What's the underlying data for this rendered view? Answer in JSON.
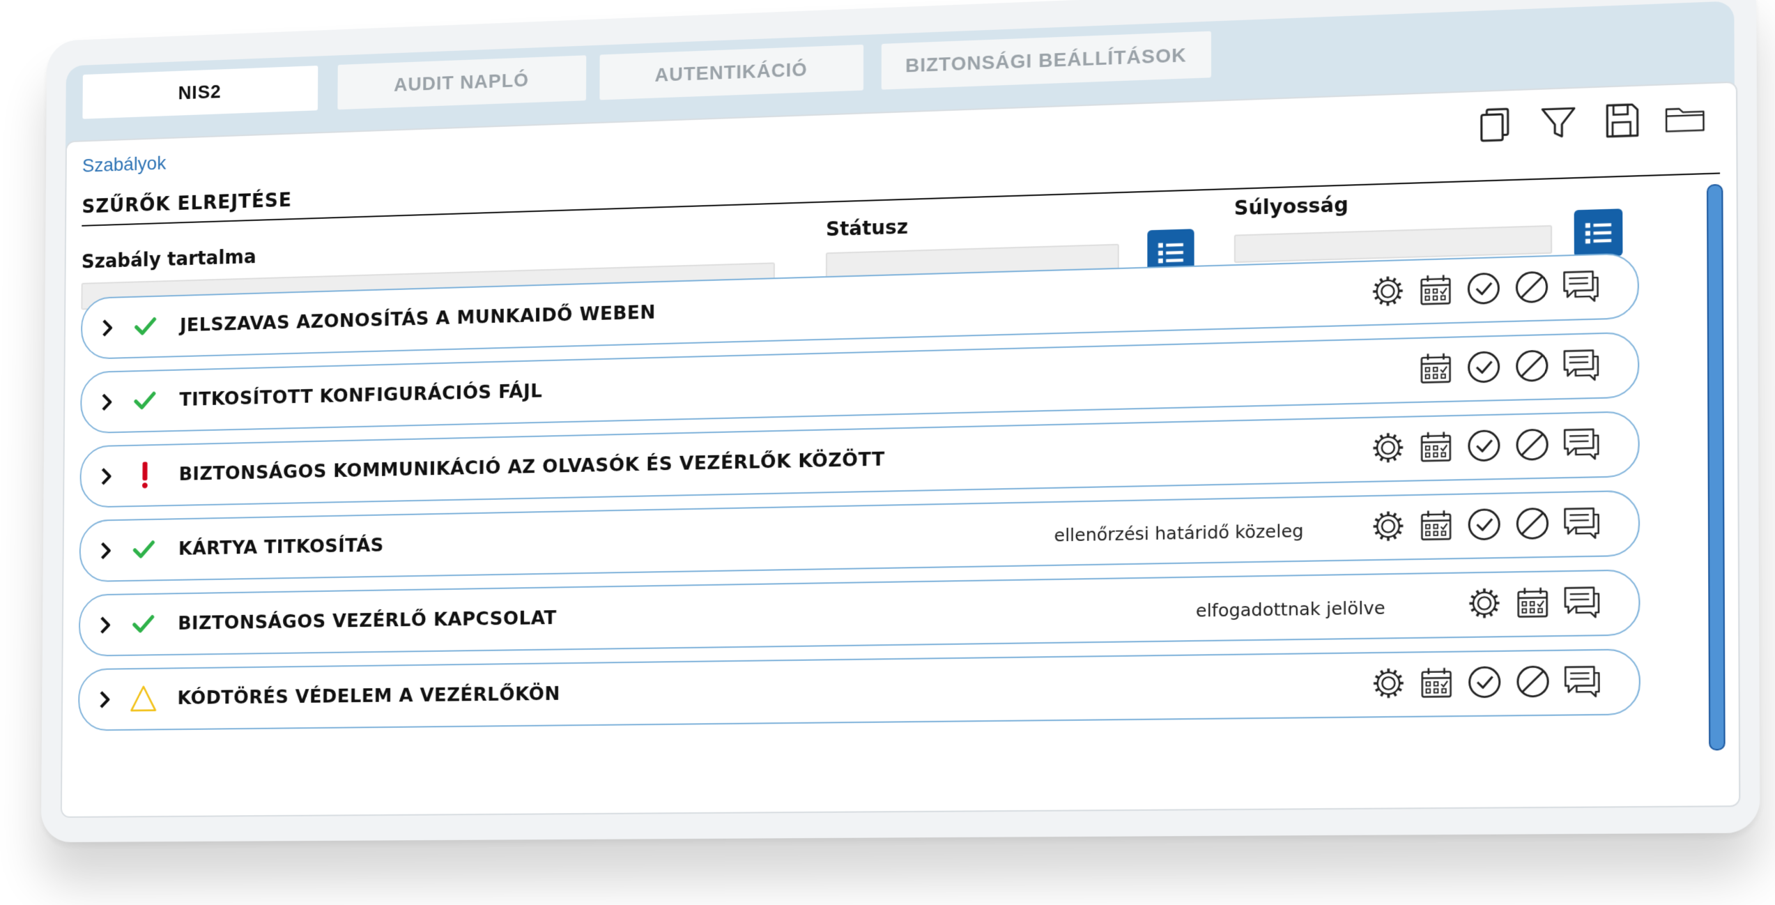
{
  "tabs": [
    {
      "label": "NIS2",
      "active": true
    },
    {
      "label": "AUDIT NAPLÓ",
      "active": false
    },
    {
      "label": "AUTENTIKÁCIÓ",
      "active": false
    },
    {
      "label": "BIZTONSÁGI BEÁLLÍTÁSOK",
      "active": false
    }
  ],
  "breadcrumb": "Szabályok",
  "hide_filters_label": "SZŰRŐK ELREJTÉSE",
  "toolbar_icons": [
    "copy-icon",
    "filter-icon",
    "save-icon",
    "folder-icon"
  ],
  "filters": {
    "rule_content": {
      "label": "Szabály tartalma",
      "value": ""
    },
    "status": {
      "label": "Státusz",
      "value": ""
    },
    "severity": {
      "label": "Súlyosság",
      "value": ""
    }
  },
  "colors": {
    "accent": "#1460a8",
    "link": "#2f74b5",
    "ok_green": "#2fb24a",
    "error_red": "#d0021b",
    "warn_yellow": "#f2c21b",
    "row_border": "#7fb2da",
    "tabbar_bg": "#d6e4ed"
  },
  "rules": [
    {
      "title": "JELSZAVAS AZONOSÍTÁS A MUNKAIDŐ WEBEN",
      "status": "ok",
      "note": "",
      "actions": [
        "gear-icon",
        "calendar-icon",
        "check-circle-icon",
        "block-icon",
        "comment-icon"
      ]
    },
    {
      "title": "TITKOSÍTOTT KONFIGURÁCIÓS FÁJL",
      "status": "ok",
      "note": "",
      "actions": [
        "calendar-icon",
        "check-circle-icon",
        "block-icon",
        "comment-icon"
      ]
    },
    {
      "title": "BIZTONSÁGOS KOMMUNIKÁCIÓ AZ OLVASÓK ÉS VEZÉRLŐK KÖZÖTT",
      "status": "error",
      "note": "",
      "actions": [
        "gear-icon",
        "calendar-icon",
        "check-circle-icon",
        "block-icon",
        "comment-icon"
      ]
    },
    {
      "title": "KÁRTYA TITKOSÍTÁS",
      "status": "ok",
      "note": "ellenőrzési határidő közeleg",
      "actions": [
        "gear-icon",
        "calendar-icon",
        "check-circle-icon",
        "block-icon",
        "comment-icon"
      ]
    },
    {
      "title": "BIZTONSÁGOS VEZÉRLŐ KAPCSOLAT",
      "status": "ok",
      "note": "elfogadottnak jelölve",
      "actions": [
        "gear-icon",
        "calendar-icon",
        "comment-icon"
      ]
    },
    {
      "title": "KÓDTÖRÉS VÉDELEM A VEZÉRLŐKÖN",
      "status": "warning",
      "note": "",
      "actions": [
        "gear-icon",
        "calendar-icon",
        "check-circle-icon",
        "block-icon",
        "comment-icon"
      ]
    }
  ]
}
